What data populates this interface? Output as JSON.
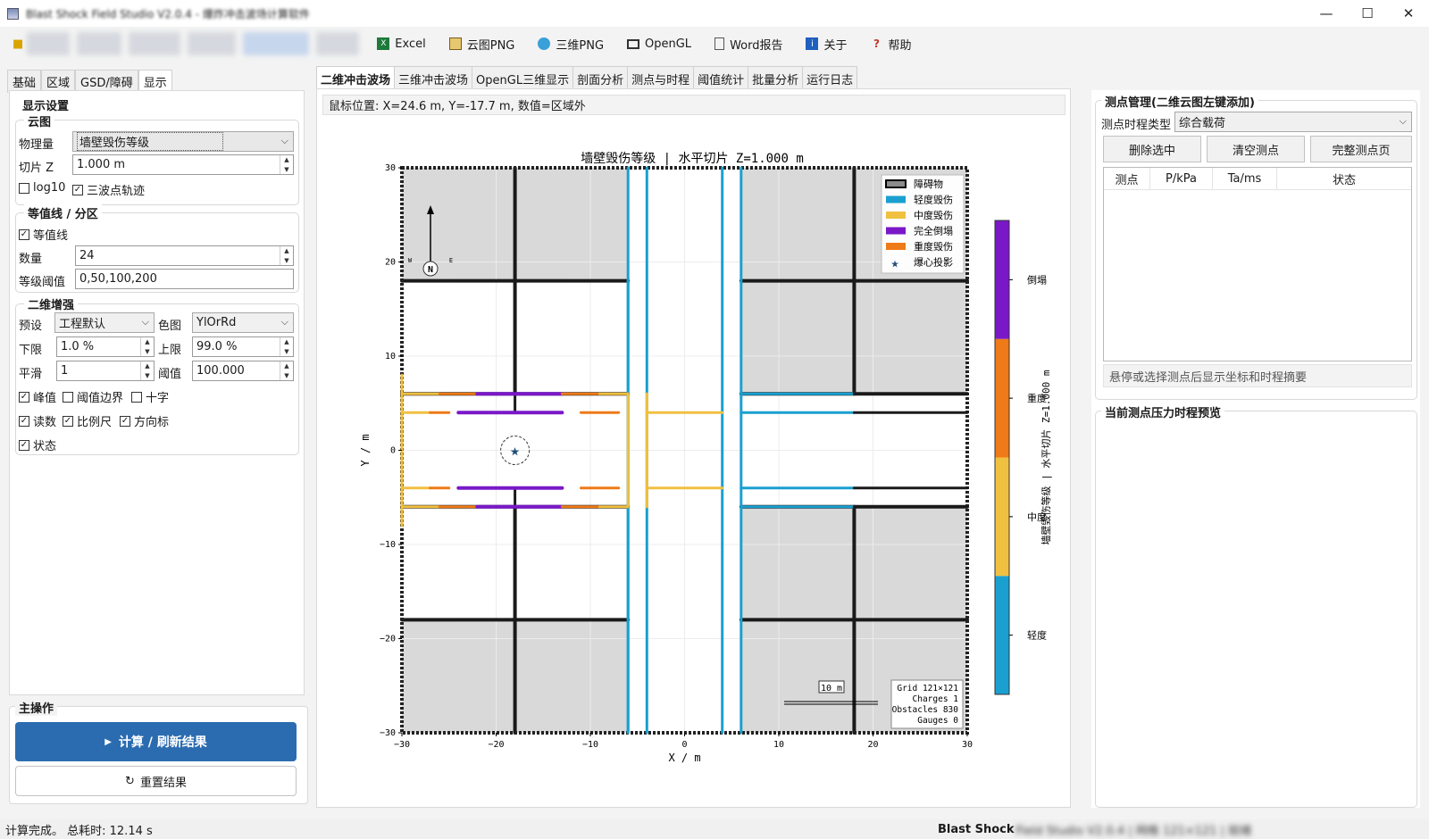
{
  "window": {
    "title": "Blast Shock Field Studio V2.0.4 - 爆炸冲击波场计算软件",
    "minimize": "—",
    "maximize": "☐",
    "close": "✕"
  },
  "toolbar": {
    "items": [
      "Excel",
      "云图PNG",
      "三维PNG",
      "OpenGL",
      "Word报告",
      "关于",
      "帮助"
    ]
  },
  "left_tabs": [
    "基础",
    "区域",
    "GSD/障碍",
    "显示"
  ],
  "display_settings": {
    "title": "显示设置",
    "cloud": {
      "title": "云图",
      "quantity_label": "物理量",
      "quantity_value": "墙壁毁伤等级",
      "slice_label": "切片 Z",
      "slice_value": "1.000 m",
      "log10": "log10",
      "log10_checked": false,
      "tri_wave": "三波点轨迹",
      "tri_wave_checked": true
    },
    "contour": {
      "title": "等值线 / 分区",
      "contour_cb": "等值线",
      "contour_checked": true,
      "count_label": "数量",
      "count_value": "24",
      "threshold_label": "等级阈值",
      "threshold_value": "0,50,100,200"
    },
    "enhance": {
      "title": "二维增强",
      "preset_label": "预设",
      "preset_value": "工程默认",
      "cmap_label": "色图",
      "cmap_value": "YlOrRd",
      "lower_label": "下限",
      "lower_value": "1.0 %",
      "upper_label": "上限",
      "upper_value": "99.0 %",
      "smooth_label": "平滑",
      "smooth_value": "1",
      "thresh_label": "阈值",
      "thresh_value": "100.000",
      "checks": [
        {
          "label": "峰值",
          "checked": true
        },
        {
          "label": "阈值边界",
          "checked": false
        },
        {
          "label": "十字",
          "checked": false
        },
        {
          "label": "读数",
          "checked": true
        },
        {
          "label": "比例尺",
          "checked": true
        },
        {
          "label": "方向标",
          "checked": true
        },
        {
          "label": "状态",
          "checked": true
        }
      ]
    }
  },
  "main_ops": {
    "title": "主操作",
    "compute": "计算 / 刷新结果",
    "reset": "重置结果"
  },
  "center_tabs": [
    "二维冲击波场",
    "三维冲击波场",
    "OpenGL三维显示",
    "剖面分析",
    "测点与时程",
    "阈值统计",
    "批量分析",
    "运行日志"
  ],
  "mouse_info": "鼠标位置: X=24.6 m, Y=-17.7 m, 数值=区域外",
  "chart_data": {
    "type": "heatmap",
    "title": "墙壁毁伤等级   |   水平切片 Z=1.000 m",
    "xlabel": "X / m",
    "ylabel": "Y / m",
    "xlim": [
      -30,
      30
    ],
    "ylim": [
      -30,
      30
    ],
    "xticks": [
      "−30",
      "−20",
      "−10",
      "0",
      "10",
      "20",
      "30"
    ],
    "yticks": [
      "30",
      "20",
      "10",
      "0",
      "−10",
      "−20",
      "−30"
    ],
    "legend": [
      "障碍物",
      "轻度毁伤",
      "中度毁伤",
      "完全倒塌",
      "重度毁伤",
      "爆心投影"
    ],
    "legend_colors": [
      "#8c8c8c",
      "#1aa0d0",
      "#f0c040",
      "#7a18c8",
      "#ee7a18",
      "#1f4e79"
    ],
    "charge": {
      "x": -18,
      "y": 0
    },
    "colorbar": {
      "label": "墙壁毁伤等级   |   水平切片 Z=1.000 m",
      "levels": [
        "轻度",
        "中度",
        "重度",
        "倒塌"
      ],
      "colors": [
        "#1aa0d0",
        "#f0c040",
        "#ee7a18",
        "#7a18c8"
      ]
    },
    "scale_bar": "10 m",
    "compass": {
      "n": "N",
      "w": "W",
      "e": "E"
    },
    "info": [
      "Grid 121×121",
      "Charges 1",
      "Obstacles 830",
      "Gauges 0"
    ]
  },
  "gauges": {
    "title": "测点管理(二维云图左键添加)",
    "type_label": "测点时程类型",
    "type_value": "综合载荷",
    "buttons": [
      "删除选中",
      "清空测点",
      "完整测点页"
    ],
    "columns": [
      "测点",
      "P/kPa",
      "Ta/ms",
      "状态"
    ],
    "hint": "悬停或选择测点后显示坐标和时程摘要",
    "preview_title": "当前测点压力时程预览"
  },
  "status": {
    "left": "计算完成。 总耗时: 12.14 s",
    "right": "Blast Shock",
    "right_blur": "Field Studio V2.0.4 | 网格 121×121 | 就绪"
  }
}
